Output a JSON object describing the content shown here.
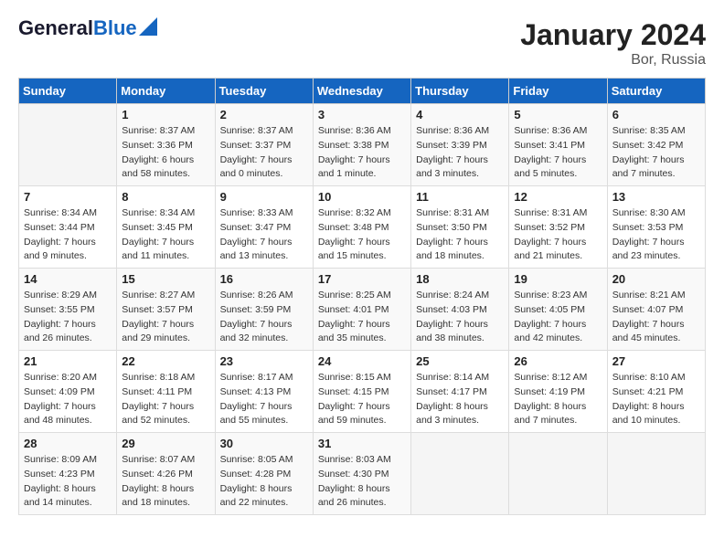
{
  "header": {
    "logo_line1": "General",
    "logo_line2": "Blue",
    "title": "January 2024",
    "subtitle": "Bor, Russia"
  },
  "columns": [
    "Sunday",
    "Monday",
    "Tuesday",
    "Wednesday",
    "Thursday",
    "Friday",
    "Saturday"
  ],
  "weeks": [
    [
      {
        "day": "",
        "info": ""
      },
      {
        "day": "1",
        "info": "Sunrise: 8:37 AM\nSunset: 3:36 PM\nDaylight: 6 hours\nand 58 minutes."
      },
      {
        "day": "2",
        "info": "Sunrise: 8:37 AM\nSunset: 3:37 PM\nDaylight: 7 hours\nand 0 minutes."
      },
      {
        "day": "3",
        "info": "Sunrise: 8:36 AM\nSunset: 3:38 PM\nDaylight: 7 hours\nand 1 minute."
      },
      {
        "day": "4",
        "info": "Sunrise: 8:36 AM\nSunset: 3:39 PM\nDaylight: 7 hours\nand 3 minutes."
      },
      {
        "day": "5",
        "info": "Sunrise: 8:36 AM\nSunset: 3:41 PM\nDaylight: 7 hours\nand 5 minutes."
      },
      {
        "day": "6",
        "info": "Sunrise: 8:35 AM\nSunset: 3:42 PM\nDaylight: 7 hours\nand 7 minutes."
      }
    ],
    [
      {
        "day": "7",
        "info": "Sunrise: 8:34 AM\nSunset: 3:44 PM\nDaylight: 7 hours\nand 9 minutes."
      },
      {
        "day": "8",
        "info": "Sunrise: 8:34 AM\nSunset: 3:45 PM\nDaylight: 7 hours\nand 11 minutes."
      },
      {
        "day": "9",
        "info": "Sunrise: 8:33 AM\nSunset: 3:47 PM\nDaylight: 7 hours\nand 13 minutes."
      },
      {
        "day": "10",
        "info": "Sunrise: 8:32 AM\nSunset: 3:48 PM\nDaylight: 7 hours\nand 15 minutes."
      },
      {
        "day": "11",
        "info": "Sunrise: 8:31 AM\nSunset: 3:50 PM\nDaylight: 7 hours\nand 18 minutes."
      },
      {
        "day": "12",
        "info": "Sunrise: 8:31 AM\nSunset: 3:52 PM\nDaylight: 7 hours\nand 21 minutes."
      },
      {
        "day": "13",
        "info": "Sunrise: 8:30 AM\nSunset: 3:53 PM\nDaylight: 7 hours\nand 23 minutes."
      }
    ],
    [
      {
        "day": "14",
        "info": "Sunrise: 8:29 AM\nSunset: 3:55 PM\nDaylight: 7 hours\nand 26 minutes."
      },
      {
        "day": "15",
        "info": "Sunrise: 8:27 AM\nSunset: 3:57 PM\nDaylight: 7 hours\nand 29 minutes."
      },
      {
        "day": "16",
        "info": "Sunrise: 8:26 AM\nSunset: 3:59 PM\nDaylight: 7 hours\nand 32 minutes."
      },
      {
        "day": "17",
        "info": "Sunrise: 8:25 AM\nSunset: 4:01 PM\nDaylight: 7 hours\nand 35 minutes."
      },
      {
        "day": "18",
        "info": "Sunrise: 8:24 AM\nSunset: 4:03 PM\nDaylight: 7 hours\nand 38 minutes."
      },
      {
        "day": "19",
        "info": "Sunrise: 8:23 AM\nSunset: 4:05 PM\nDaylight: 7 hours\nand 42 minutes."
      },
      {
        "day": "20",
        "info": "Sunrise: 8:21 AM\nSunset: 4:07 PM\nDaylight: 7 hours\nand 45 minutes."
      }
    ],
    [
      {
        "day": "21",
        "info": "Sunrise: 8:20 AM\nSunset: 4:09 PM\nDaylight: 7 hours\nand 48 minutes."
      },
      {
        "day": "22",
        "info": "Sunrise: 8:18 AM\nSunset: 4:11 PM\nDaylight: 7 hours\nand 52 minutes."
      },
      {
        "day": "23",
        "info": "Sunrise: 8:17 AM\nSunset: 4:13 PM\nDaylight: 7 hours\nand 55 minutes."
      },
      {
        "day": "24",
        "info": "Sunrise: 8:15 AM\nSunset: 4:15 PM\nDaylight: 7 hours\nand 59 minutes."
      },
      {
        "day": "25",
        "info": "Sunrise: 8:14 AM\nSunset: 4:17 PM\nDaylight: 8 hours\nand 3 minutes."
      },
      {
        "day": "26",
        "info": "Sunrise: 8:12 AM\nSunset: 4:19 PM\nDaylight: 8 hours\nand 7 minutes."
      },
      {
        "day": "27",
        "info": "Sunrise: 8:10 AM\nSunset: 4:21 PM\nDaylight: 8 hours\nand 10 minutes."
      }
    ],
    [
      {
        "day": "28",
        "info": "Sunrise: 8:09 AM\nSunset: 4:23 PM\nDaylight: 8 hours\nand 14 minutes."
      },
      {
        "day": "29",
        "info": "Sunrise: 8:07 AM\nSunset: 4:26 PM\nDaylight: 8 hours\nand 18 minutes."
      },
      {
        "day": "30",
        "info": "Sunrise: 8:05 AM\nSunset: 4:28 PM\nDaylight: 8 hours\nand 22 minutes."
      },
      {
        "day": "31",
        "info": "Sunrise: 8:03 AM\nSunset: 4:30 PM\nDaylight: 8 hours\nand 26 minutes."
      },
      {
        "day": "",
        "info": ""
      },
      {
        "day": "",
        "info": ""
      },
      {
        "day": "",
        "info": ""
      }
    ]
  ]
}
